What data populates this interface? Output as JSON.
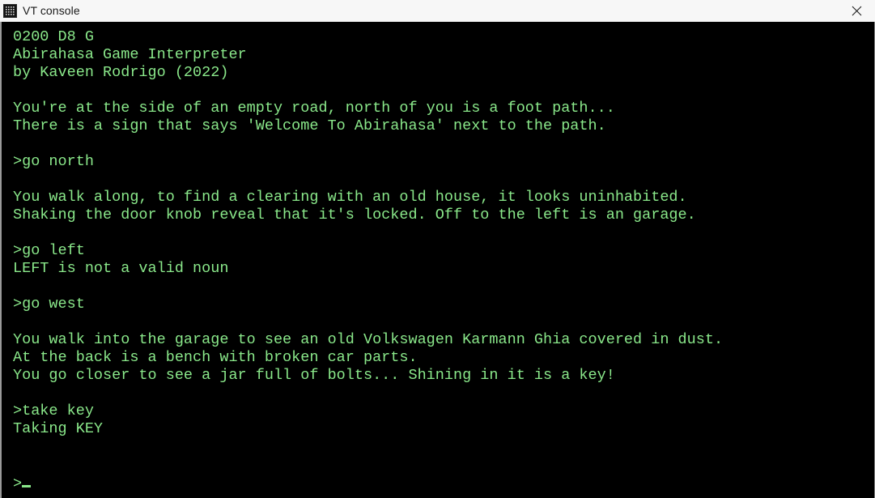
{
  "window": {
    "title": "VT console",
    "icon": "terminal-dots-icon",
    "close_label": "✕",
    "background_color": "#000000",
    "text_color": "#8ae88a",
    "titlebar_color": "#f7f7f7"
  },
  "terminal": {
    "lines": [
      "0200 D8 G",
      "Abirahasa Game Interpreter",
      "by Kaveen Rodrigo (2022)",
      "",
      "You're at the side of an empty road, north of you is a foot path...",
      "There is a sign that says 'Welcome To Abirahasa' next to the path.",
      "",
      ">go north",
      "",
      "You walk along, to find a clearing with an old house, it looks uninhabited.",
      "Shaking the door knob reveal that it's locked. Off to the left is an garage.",
      "",
      ">go left",
      "LEFT is not a valid noun",
      "",
      ">go west",
      "",
      "You walk into the garage to see an old Volkswagen Karmann Ghia covered in dust.",
      "At the back is a bench with broken car parts.",
      "You go closer to see a jar full of bolts... Shining in it is a key!",
      "",
      ">take key",
      "Taking KEY",
      "",
      ""
    ],
    "prompt": ">",
    "cursor": "_"
  }
}
